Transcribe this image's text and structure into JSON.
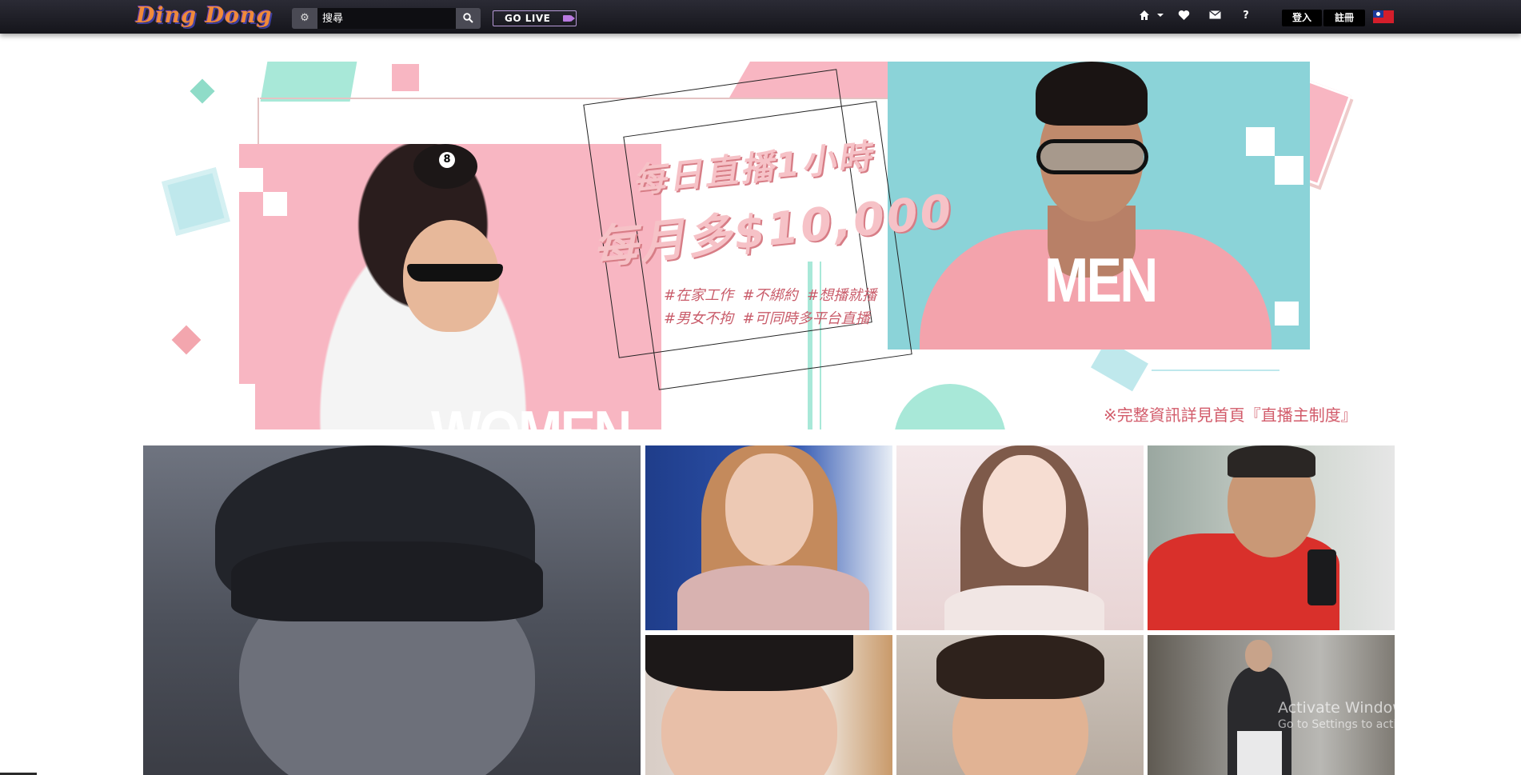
{
  "header": {
    "logo_text": "Ding Dong",
    "search": {
      "value": "搜尋",
      "placeholder": "搜尋"
    },
    "go_live_label": "GO LIVE",
    "login_label": "登入",
    "register_label": "註冊",
    "icons": [
      "gear-icon",
      "search-icon",
      "camera-icon",
      "home-icon",
      "caret-down-icon",
      "heart-icon",
      "envelope-icon",
      "help-icon",
      "taiwan-flag-icon"
    ]
  },
  "banner": {
    "women_label": "WOMEN",
    "men_label": "MEN",
    "promo_line1": "每日直播1小時",
    "promo_line2": "每月多$10,000",
    "hashtags_line1": "#在家工作  #不綁約  #想播就播",
    "hashtags_line2": "#男女不拘  #可同時多平台直播",
    "footnote": "※完整資訊詳見首頁『直播主制度』",
    "colors": {
      "pink": "#f8b6c2",
      "teal": "#8bd3d8",
      "mint": "#a8e8d8",
      "text_pink": "#d25b6a"
    }
  },
  "grid": {
    "thumbnails": [
      "thumb-1",
      "thumb-2",
      "thumb-3",
      "thumb-4",
      "thumb-5",
      "thumb-6",
      "thumb-7"
    ]
  },
  "watermark": {
    "title": "Activate Windows",
    "subtitle": "Go to Settings to activate Windows."
  }
}
